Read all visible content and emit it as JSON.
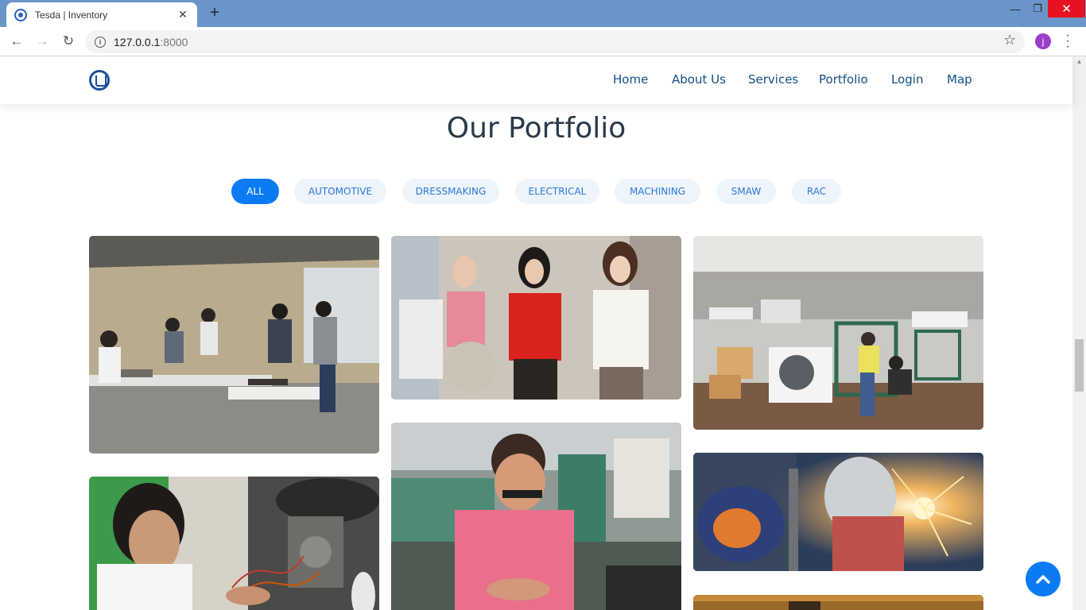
{
  "browser": {
    "tab_title": "Tesda | Inventory",
    "tab_close": "✕",
    "new_tab": "+",
    "url_host": "127.0.0.1",
    "url_port": ":8000",
    "profile_initial": "j",
    "controls": {
      "minimize": "—",
      "maximize": "❐",
      "close": "✕"
    }
  },
  "header": {
    "nav": [
      "Home",
      "About Us",
      "Services",
      "Portfolio",
      "Login",
      "Map"
    ]
  },
  "portfolio": {
    "title": "Our Portfolio",
    "filters": [
      "ALL",
      "AUTOMOTIVE",
      "DRESSMAKING",
      "ELECTRICAL",
      "MACHINING",
      "SMAW",
      "RAC"
    ],
    "active_filter": "ALL"
  },
  "colors": {
    "accent": "#0b7bf3",
    "nav_text": "#124f86",
    "title_text": "#293a4a",
    "filter_bg": "#eef4fb"
  }
}
